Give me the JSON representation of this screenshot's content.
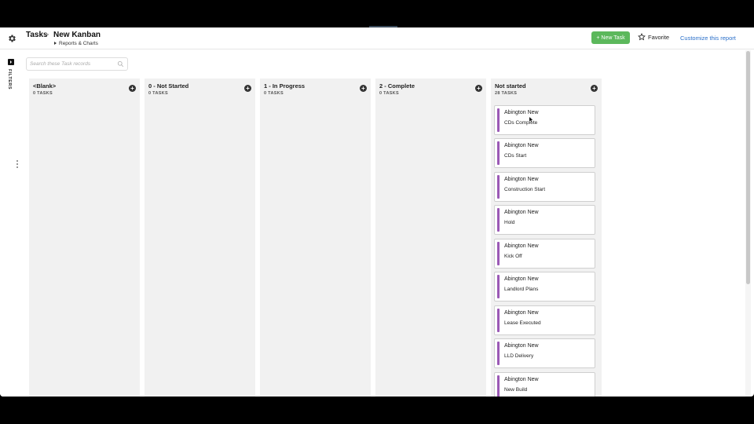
{
  "header": {
    "breadcrumb_root": "Tasks",
    "breadcrumb_sep": ">",
    "title": "New Kanban",
    "reports_label": "Reports & Charts",
    "new_task_label": "+ New Task",
    "favorite_label": "Favorite",
    "customize_label": "Customize this report"
  },
  "sidebar": {
    "filters_label": "FILTERS"
  },
  "search": {
    "placeholder": "Search these Task records"
  },
  "columns": [
    {
      "title": "<Blank>",
      "count": "0 TASKS"
    },
    {
      "title": "0 - Not Started",
      "count": "0 TASKS"
    },
    {
      "title": "1 - In Progress",
      "count": "0 TASKS"
    },
    {
      "title": "2 - Complete",
      "count": "0 TASKS"
    },
    {
      "title": "Not started",
      "count": "28 TASKS"
    }
  ],
  "cards": [
    {
      "project": "Abington New",
      "task": "CDs Complete"
    },
    {
      "project": "Abington New",
      "task": "CDs Start"
    },
    {
      "project": "Abington New",
      "task": "Construction Start"
    },
    {
      "project": "Abington New",
      "task": "Hold"
    },
    {
      "project": "Abington New",
      "task": "Kick Off"
    },
    {
      "project": "Abington New",
      "task": "Landlord Plans"
    },
    {
      "project": "Abington New",
      "task": "Lease Executed"
    },
    {
      "project": "Abington New",
      "task": "LLD Delivery"
    },
    {
      "project": "Abington New",
      "task": "New Build"
    }
  ],
  "colors": {
    "accent_green": "#5cb85c",
    "card_bar": "#9b59b6",
    "link_blue": "#2a6fc9"
  }
}
